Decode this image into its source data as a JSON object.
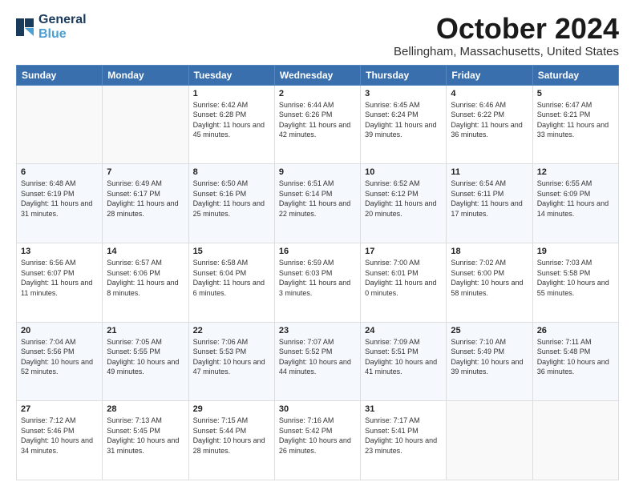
{
  "logo": {
    "line1": "General",
    "line2": "Blue"
  },
  "header": {
    "month": "October 2024",
    "location": "Bellingham, Massachusetts, United States"
  },
  "weekdays": [
    "Sunday",
    "Monday",
    "Tuesday",
    "Wednesday",
    "Thursday",
    "Friday",
    "Saturday"
  ],
  "weeks": [
    [
      {
        "day": "",
        "sunrise": "",
        "sunset": "",
        "daylight": ""
      },
      {
        "day": "",
        "sunrise": "",
        "sunset": "",
        "daylight": ""
      },
      {
        "day": "1",
        "sunrise": "Sunrise: 6:42 AM",
        "sunset": "Sunset: 6:28 PM",
        "daylight": "Daylight: 11 hours and 45 minutes."
      },
      {
        "day": "2",
        "sunrise": "Sunrise: 6:44 AM",
        "sunset": "Sunset: 6:26 PM",
        "daylight": "Daylight: 11 hours and 42 minutes."
      },
      {
        "day": "3",
        "sunrise": "Sunrise: 6:45 AM",
        "sunset": "Sunset: 6:24 PM",
        "daylight": "Daylight: 11 hours and 39 minutes."
      },
      {
        "day": "4",
        "sunrise": "Sunrise: 6:46 AM",
        "sunset": "Sunset: 6:22 PM",
        "daylight": "Daylight: 11 hours and 36 minutes."
      },
      {
        "day": "5",
        "sunrise": "Sunrise: 6:47 AM",
        "sunset": "Sunset: 6:21 PM",
        "daylight": "Daylight: 11 hours and 33 minutes."
      }
    ],
    [
      {
        "day": "6",
        "sunrise": "Sunrise: 6:48 AM",
        "sunset": "Sunset: 6:19 PM",
        "daylight": "Daylight: 11 hours and 31 minutes."
      },
      {
        "day": "7",
        "sunrise": "Sunrise: 6:49 AM",
        "sunset": "Sunset: 6:17 PM",
        "daylight": "Daylight: 11 hours and 28 minutes."
      },
      {
        "day": "8",
        "sunrise": "Sunrise: 6:50 AM",
        "sunset": "Sunset: 6:16 PM",
        "daylight": "Daylight: 11 hours and 25 minutes."
      },
      {
        "day": "9",
        "sunrise": "Sunrise: 6:51 AM",
        "sunset": "Sunset: 6:14 PM",
        "daylight": "Daylight: 11 hours and 22 minutes."
      },
      {
        "day": "10",
        "sunrise": "Sunrise: 6:52 AM",
        "sunset": "Sunset: 6:12 PM",
        "daylight": "Daylight: 11 hours and 20 minutes."
      },
      {
        "day": "11",
        "sunrise": "Sunrise: 6:54 AM",
        "sunset": "Sunset: 6:11 PM",
        "daylight": "Daylight: 11 hours and 17 minutes."
      },
      {
        "day": "12",
        "sunrise": "Sunrise: 6:55 AM",
        "sunset": "Sunset: 6:09 PM",
        "daylight": "Daylight: 11 hours and 14 minutes."
      }
    ],
    [
      {
        "day": "13",
        "sunrise": "Sunrise: 6:56 AM",
        "sunset": "Sunset: 6:07 PM",
        "daylight": "Daylight: 11 hours and 11 minutes."
      },
      {
        "day": "14",
        "sunrise": "Sunrise: 6:57 AM",
        "sunset": "Sunset: 6:06 PM",
        "daylight": "Daylight: 11 hours and 8 minutes."
      },
      {
        "day": "15",
        "sunrise": "Sunrise: 6:58 AM",
        "sunset": "Sunset: 6:04 PM",
        "daylight": "Daylight: 11 hours and 6 minutes."
      },
      {
        "day": "16",
        "sunrise": "Sunrise: 6:59 AM",
        "sunset": "Sunset: 6:03 PM",
        "daylight": "Daylight: 11 hours and 3 minutes."
      },
      {
        "day": "17",
        "sunrise": "Sunrise: 7:00 AM",
        "sunset": "Sunset: 6:01 PM",
        "daylight": "Daylight: 11 hours and 0 minutes."
      },
      {
        "day": "18",
        "sunrise": "Sunrise: 7:02 AM",
        "sunset": "Sunset: 6:00 PM",
        "daylight": "Daylight: 10 hours and 58 minutes."
      },
      {
        "day": "19",
        "sunrise": "Sunrise: 7:03 AM",
        "sunset": "Sunset: 5:58 PM",
        "daylight": "Daylight: 10 hours and 55 minutes."
      }
    ],
    [
      {
        "day": "20",
        "sunrise": "Sunrise: 7:04 AM",
        "sunset": "Sunset: 5:56 PM",
        "daylight": "Daylight: 10 hours and 52 minutes."
      },
      {
        "day": "21",
        "sunrise": "Sunrise: 7:05 AM",
        "sunset": "Sunset: 5:55 PM",
        "daylight": "Daylight: 10 hours and 49 minutes."
      },
      {
        "day": "22",
        "sunrise": "Sunrise: 7:06 AM",
        "sunset": "Sunset: 5:53 PM",
        "daylight": "Daylight: 10 hours and 47 minutes."
      },
      {
        "day": "23",
        "sunrise": "Sunrise: 7:07 AM",
        "sunset": "Sunset: 5:52 PM",
        "daylight": "Daylight: 10 hours and 44 minutes."
      },
      {
        "day": "24",
        "sunrise": "Sunrise: 7:09 AM",
        "sunset": "Sunset: 5:51 PM",
        "daylight": "Daylight: 10 hours and 41 minutes."
      },
      {
        "day": "25",
        "sunrise": "Sunrise: 7:10 AM",
        "sunset": "Sunset: 5:49 PM",
        "daylight": "Daylight: 10 hours and 39 minutes."
      },
      {
        "day": "26",
        "sunrise": "Sunrise: 7:11 AM",
        "sunset": "Sunset: 5:48 PM",
        "daylight": "Daylight: 10 hours and 36 minutes."
      }
    ],
    [
      {
        "day": "27",
        "sunrise": "Sunrise: 7:12 AM",
        "sunset": "Sunset: 5:46 PM",
        "daylight": "Daylight: 10 hours and 34 minutes."
      },
      {
        "day": "28",
        "sunrise": "Sunrise: 7:13 AM",
        "sunset": "Sunset: 5:45 PM",
        "daylight": "Daylight: 10 hours and 31 minutes."
      },
      {
        "day": "29",
        "sunrise": "Sunrise: 7:15 AM",
        "sunset": "Sunset: 5:44 PM",
        "daylight": "Daylight: 10 hours and 28 minutes."
      },
      {
        "day": "30",
        "sunrise": "Sunrise: 7:16 AM",
        "sunset": "Sunset: 5:42 PM",
        "daylight": "Daylight: 10 hours and 26 minutes."
      },
      {
        "day": "31",
        "sunrise": "Sunrise: 7:17 AM",
        "sunset": "Sunset: 5:41 PM",
        "daylight": "Daylight: 10 hours and 23 minutes."
      },
      {
        "day": "",
        "sunrise": "",
        "sunset": "",
        "daylight": ""
      },
      {
        "day": "",
        "sunrise": "",
        "sunset": "",
        "daylight": ""
      }
    ]
  ]
}
